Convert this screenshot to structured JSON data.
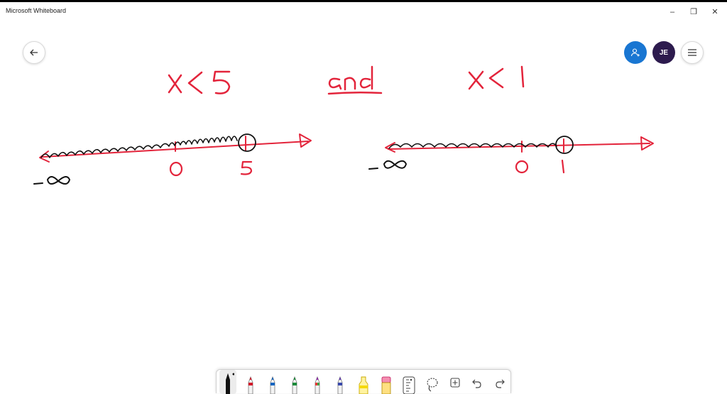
{
  "app": {
    "title": "Microsoft Whiteboard"
  },
  "window_controls": {
    "minimize": "–",
    "restore": "❐",
    "close": "✕"
  },
  "header": {
    "avatar_initials": "JE"
  },
  "ink": {
    "left_expression": "x < 5",
    "connector": "and",
    "right_expression": "x < 1",
    "left_line_labels": [
      "-∞",
      "0",
      "5"
    ],
    "right_line_labels": [
      "-∞",
      "0",
      "1"
    ],
    "ink_color_red": "#e3243b",
    "ink_color_black": "#111111"
  },
  "toolbar": {
    "tools": [
      "black-pen",
      "red-pen",
      "blue-pen",
      "green-pen",
      "rainbow-pen",
      "galaxy-pen",
      "highlighter",
      "eraser",
      "ruler",
      "lasso",
      "add",
      "undo",
      "redo"
    ]
  }
}
